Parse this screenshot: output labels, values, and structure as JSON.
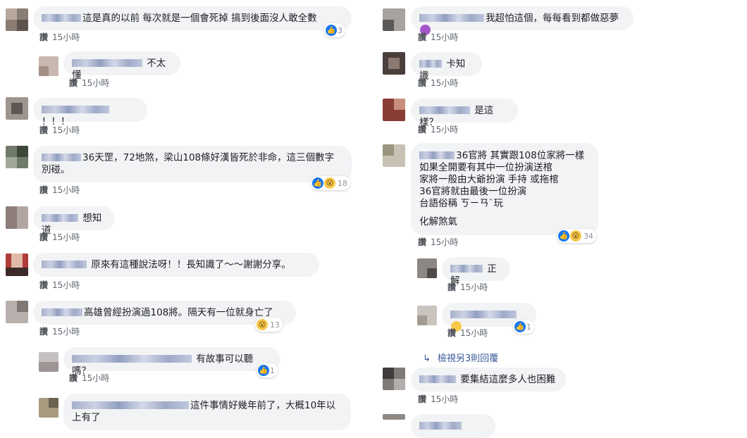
{
  "like_label": "讚",
  "time_label": "15小時",
  "left": [
    {
      "text": "這是真的以前 每次就是一個會死掉 搞到後面沒人敢全數",
      "count": "3"
    },
    {
      "text": "不太懂"
    },
    {
      "text": "！！！"
    },
    {
      "text": "36天罡，72地煞，梁山108條好漢皆死於非命，這三個數字別碰。",
      "count": "18"
    },
    {
      "text": "想知道"
    },
    {
      "text": "原來有這種說法呀！！長知識了～～謝謝分享。"
    },
    {
      "text": "高雄曾經扮演過108將。隔天有一位就身亡了",
      "count": "13"
    },
    {
      "text": "有故事可以聽嗎？",
      "count": "1"
    },
    {
      "text": "這件事情好幾年前了，大概10年以上有了"
    }
  ],
  "right": [
    {
      "text": "我超怕這個，每每看到都做惡夢"
    },
    {
      "text": "卡知識"
    },
    {
      "text": "是這樣？"
    },
    {
      "lines": [
        "36官將 其實跟108位家將一樣",
        "如果全開要有其中一位扮演送棺",
        "家將一般由大爺扮演 手持 或拖棺",
        "36官將就由最後一位扮演",
        "台語俗稱 ㄎㄧㄢˋ玩",
        "化解煞氣"
      ],
      "count": "34"
    },
    {
      "text": "正解"
    },
    {
      "count": "1"
    },
    {
      "text": "要集結這麼多人也困難"
    }
  ],
  "view_more": "檢視另3則回覆"
}
